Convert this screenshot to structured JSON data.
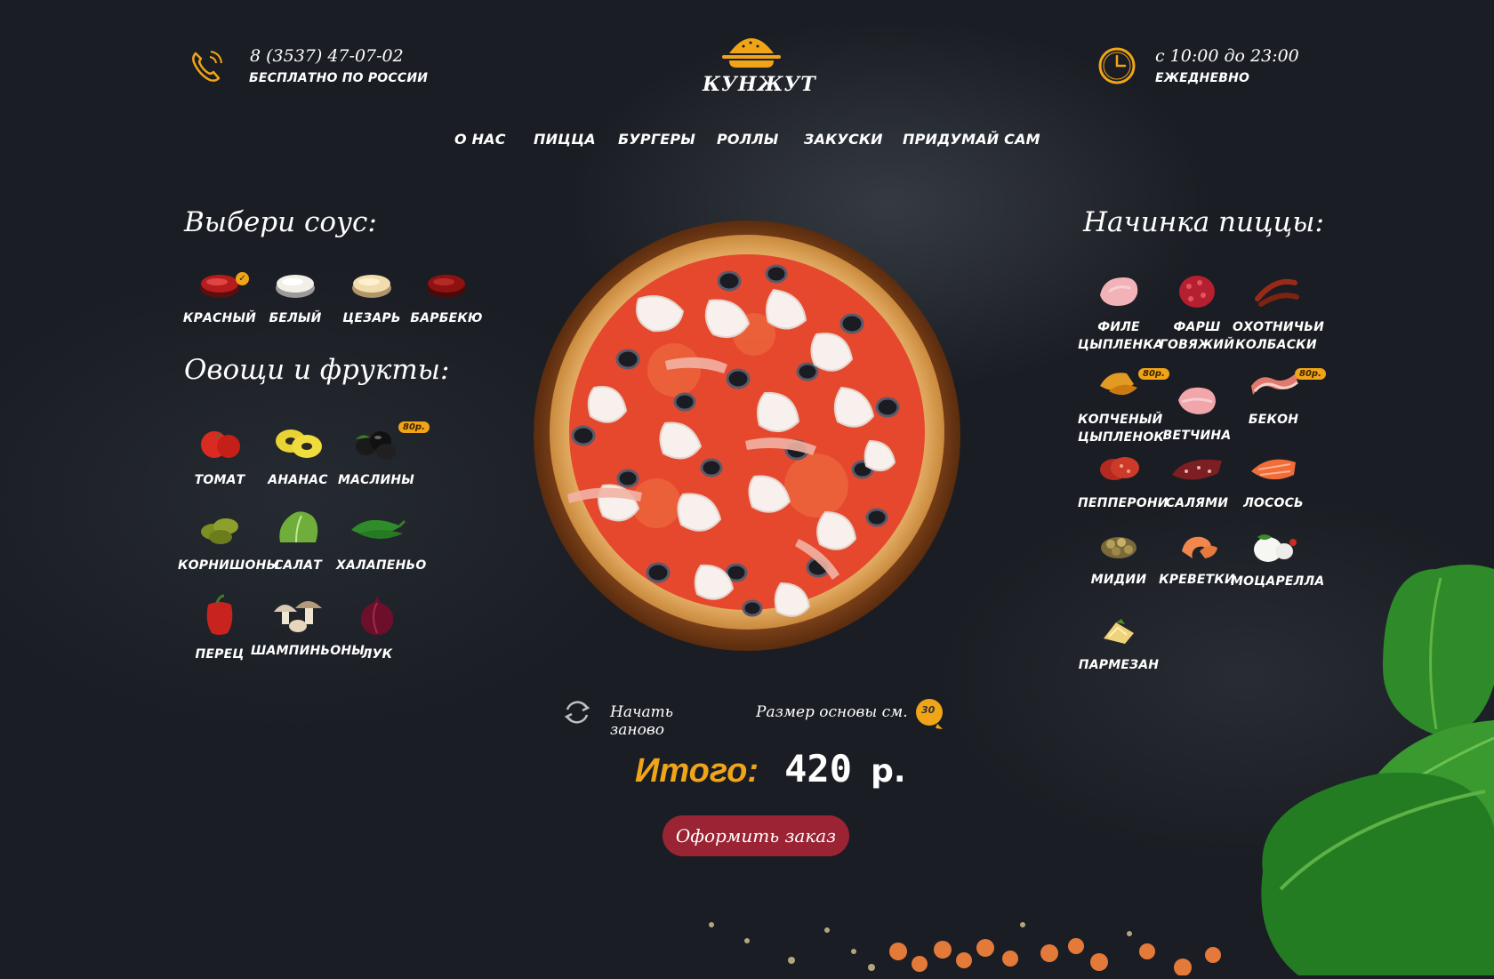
{
  "header": {
    "phone": "8 (3537) 47-07-02",
    "phone_note": "БЕСПЛАТНО ПО РОССИИ",
    "brand": "КУНЖУТ",
    "hours": "с 10:00 до 23:00",
    "hours_note": "ЕЖЕДНЕВНО"
  },
  "nav": [
    "О НАС",
    "ПИЦЦА",
    "БУРГЕРЫ",
    "РОЛЛЫ",
    "ЗАКУСКИ",
    "ПРИДУМАЙ САМ"
  ],
  "sauce": {
    "title": "Выбери соус:",
    "items": [
      {
        "label": "КРАСНЫЙ",
        "selected": true
      },
      {
        "label": "БЕЛЫЙ"
      },
      {
        "label": "ЦЕЗАРЬ"
      },
      {
        "label": "БАРБЕКЮ"
      }
    ]
  },
  "veg": {
    "title": "Овощи и фрукты:",
    "items": [
      {
        "label": "ТОМАТ"
      },
      {
        "label": "АНАНАС"
      },
      {
        "label": "МАСЛИНЫ",
        "badge": "80р."
      },
      {
        "label": "КОРНИШОНЫ"
      },
      {
        "label": "САЛАТ"
      },
      {
        "label": "ХАЛАПЕНЬО"
      },
      {
        "label": "ПЕРЕЦ"
      },
      {
        "label": "ШАМПИНЬОНЫ"
      },
      {
        "label": "ЛУК"
      }
    ]
  },
  "filling": {
    "title": "Начинка пиццы:",
    "items": [
      {
        "l1": "ФИЛЕ",
        "l2": "ЦЫПЛЕНКА"
      },
      {
        "l1": "ФАРШ",
        "l2": "ГОВЯЖИЙ"
      },
      {
        "l1": "ОХОТНИЧЬИ",
        "l2": "КОЛБАСКИ"
      },
      {
        "l1": "КОПЧЕНЫЙ",
        "l2": "ЦЫПЛЕНОК",
        "badge": "80р."
      },
      {
        "l1": "ВЕТЧИНА"
      },
      {
        "l1": "БЕКОН",
        "badge": "80р."
      },
      {
        "l1": "ПЕППЕРОНИ"
      },
      {
        "l1": "САЛЯМИ"
      },
      {
        "l1": "ЛОСОСЬ"
      },
      {
        "l1": "МИДИИ"
      },
      {
        "l1": "КРЕВЕТКИ"
      },
      {
        "l1": "МОЦАРЕЛЛА"
      },
      {
        "l1": "ПАРМЕЗАН"
      }
    ]
  },
  "controls": {
    "restart": "Начать заново",
    "size_label": "Размер основы см.",
    "size_value": "30"
  },
  "total": {
    "label": "Итого:",
    "value": "420",
    "currency": "р."
  },
  "order_button": "Оформить заказ",
  "colors": {
    "accent": "#f0a418",
    "button": "#9a2433",
    "background": "#1a1d23"
  }
}
